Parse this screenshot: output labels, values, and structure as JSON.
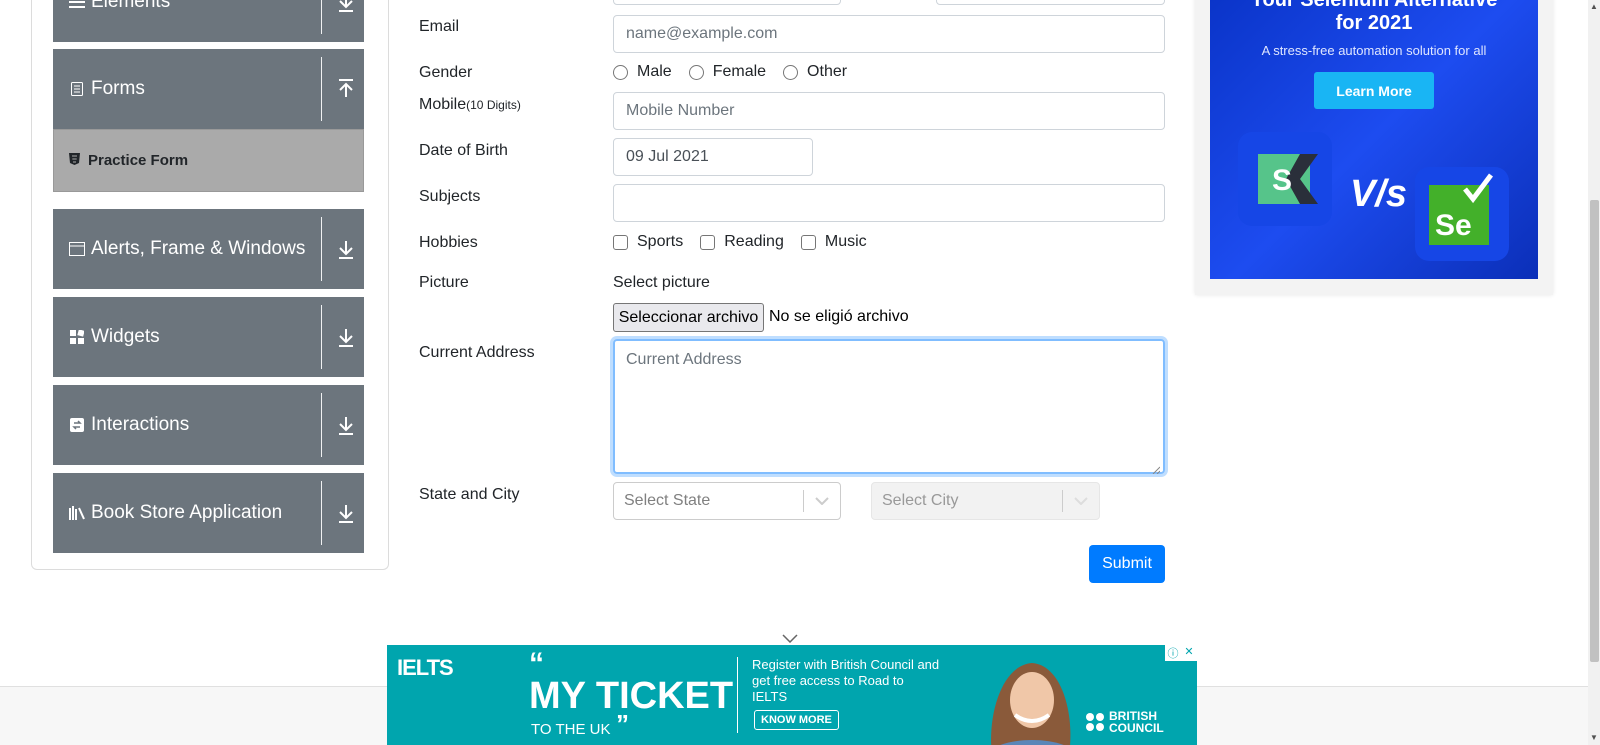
{
  "sidebar": {
    "groups": [
      {
        "label": "Elements",
        "icon": "list-icon"
      },
      {
        "label": "Forms",
        "icon": "document-icon"
      },
      {
        "label": "Alerts, Frame & Windows",
        "icon": "window-icon"
      },
      {
        "label": "Widgets",
        "icon": "widgets-icon"
      },
      {
        "label": "Interactions",
        "icon": "interactions-icon"
      },
      {
        "label": "Book Store Application",
        "icon": "books-icon"
      }
    ],
    "active_item": {
      "label": "Practice Form",
      "icon": "html5-icon"
    }
  },
  "form": {
    "email_label": "Email",
    "email_placeholder": "name@example.com",
    "gender_label": "Gender",
    "gender_options": [
      "Male",
      "Female",
      "Other"
    ],
    "mobile_label": "Mobile",
    "mobile_hint": "(10 Digits)",
    "mobile_placeholder": "Mobile Number",
    "dob_label": "Date of Birth",
    "dob_value": "09 Jul 2021",
    "subjects_label": "Subjects",
    "subjects_value": "",
    "hobbies_label": "Hobbies",
    "hobbies_options": [
      "Sports",
      "Reading",
      "Music"
    ],
    "picture_label": "Picture",
    "picture_caption": "Select picture",
    "file_button": "Seleccionar archivo",
    "file_status": "No se eligió archivo",
    "address_label": "Current Address",
    "address_placeholder": "Current Address",
    "state_city_label": "State and City",
    "state_placeholder": "Select State",
    "city_placeholder": "Select City",
    "submit_label": "Submit"
  },
  "ad_right": {
    "title": "Your Selenium Alternative",
    "title2": "for 2021",
    "subtitle": "A stress-free automation solution for all",
    "button": "Learn More",
    "vs": "V/s",
    "logo_left": "S",
    "logo_right": "Se"
  },
  "ad_bottom": {
    "brand": "IELTS",
    "headline": "MY TICKET",
    "subline": "TO THE UK",
    "body": "Register with British Council and get free access to Road to IELTS",
    "cta": "KNOW MORE",
    "sponsor_line1": "BRITISH",
    "sponsor_line2": "COUNCIL"
  },
  "colors": {
    "sidebar_group": "#6c757d",
    "active_item": "#aaaaaa",
    "primary": "#007bff",
    "ad_blue": "#1d4cf0",
    "ad_teal": "#00a5ae"
  }
}
